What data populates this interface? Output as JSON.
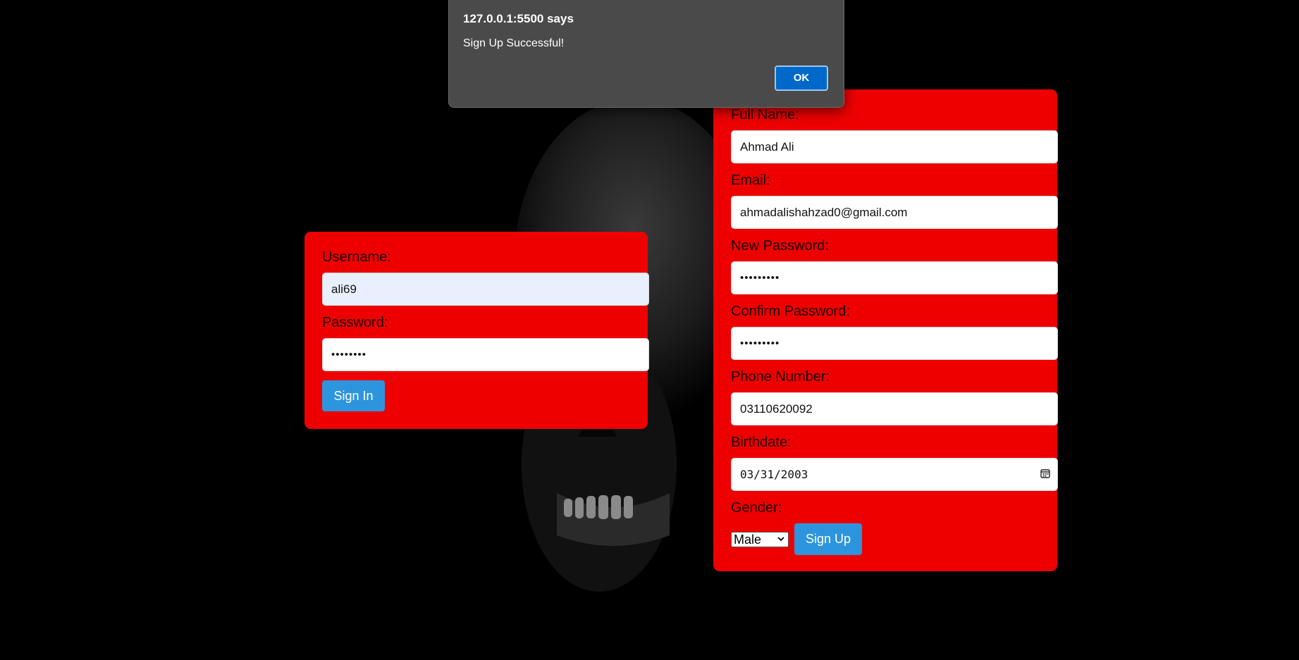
{
  "dialog": {
    "title": "127.0.0.1:5500 says",
    "message": "Sign Up Successful!",
    "ok_label": "OK"
  },
  "signin": {
    "username_label": "Username:",
    "username_value": "ali69",
    "password_label": "Password:",
    "password_value": "••••••••",
    "button_label": "Sign In"
  },
  "signup": {
    "fullname_label": "Full Name:",
    "fullname_value": "Ahmad Ali",
    "email_label": "Email:",
    "email_value": "ahmadalishahzad0@gmail.com",
    "new_password_label": "New Password:",
    "new_password_value": "•••••••••",
    "confirm_password_label": "Confirm Password:",
    "confirm_password_value": "•••••••••",
    "phone_label": "Phone Number:",
    "phone_value": "03110620092",
    "birthdate_label": "Birthdate:",
    "birthdate_value": "03/31/2003",
    "gender_label": "Gender:",
    "gender_value": "Male",
    "button_label": "Sign Up"
  },
  "icons": {
    "calendar": "calendar-icon",
    "dropdown": "chevron-down-icon",
    "background": "skull-image"
  },
  "colors": {
    "card_background": "#ee0000",
    "button": "#2d95dd",
    "dialog_background": "#4a4a4a",
    "ok_button": "#0068c9",
    "autofill_field": "#e8f0fe"
  }
}
